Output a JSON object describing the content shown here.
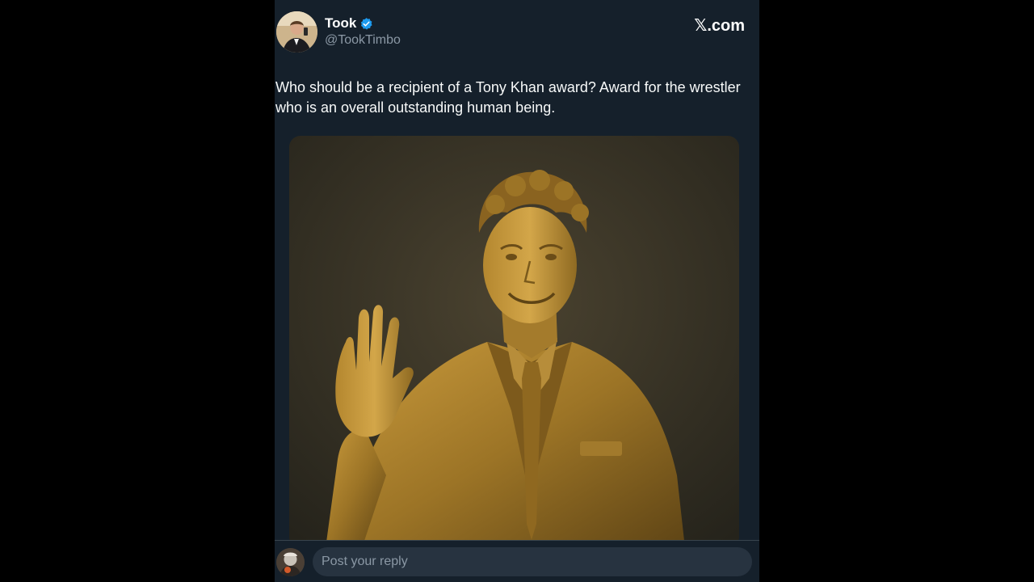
{
  "tweet": {
    "author_name": "Took",
    "author_handle": "@TookTimbo",
    "verified": true,
    "text": "Who should be a recipient of a Tony Khan award?  Award for the wrestler who is an overall outstanding human being.",
    "media_description": "bronze statue of a smiling man in a suit waving"
  },
  "branding": {
    "site_logo": "𝕏.com"
  },
  "reply": {
    "placeholder": "Post your reply"
  },
  "icons": {
    "verified": "verified-badge-icon",
    "logo": "x-logo-icon"
  },
  "colors": {
    "page_bg": "#000000",
    "panel_bg": "#15202b",
    "text_primary": "#f7f9f9",
    "text_secondary": "#8b98a5",
    "verified_blue": "#1d9bf0",
    "reply_input_bg": "#273340"
  }
}
